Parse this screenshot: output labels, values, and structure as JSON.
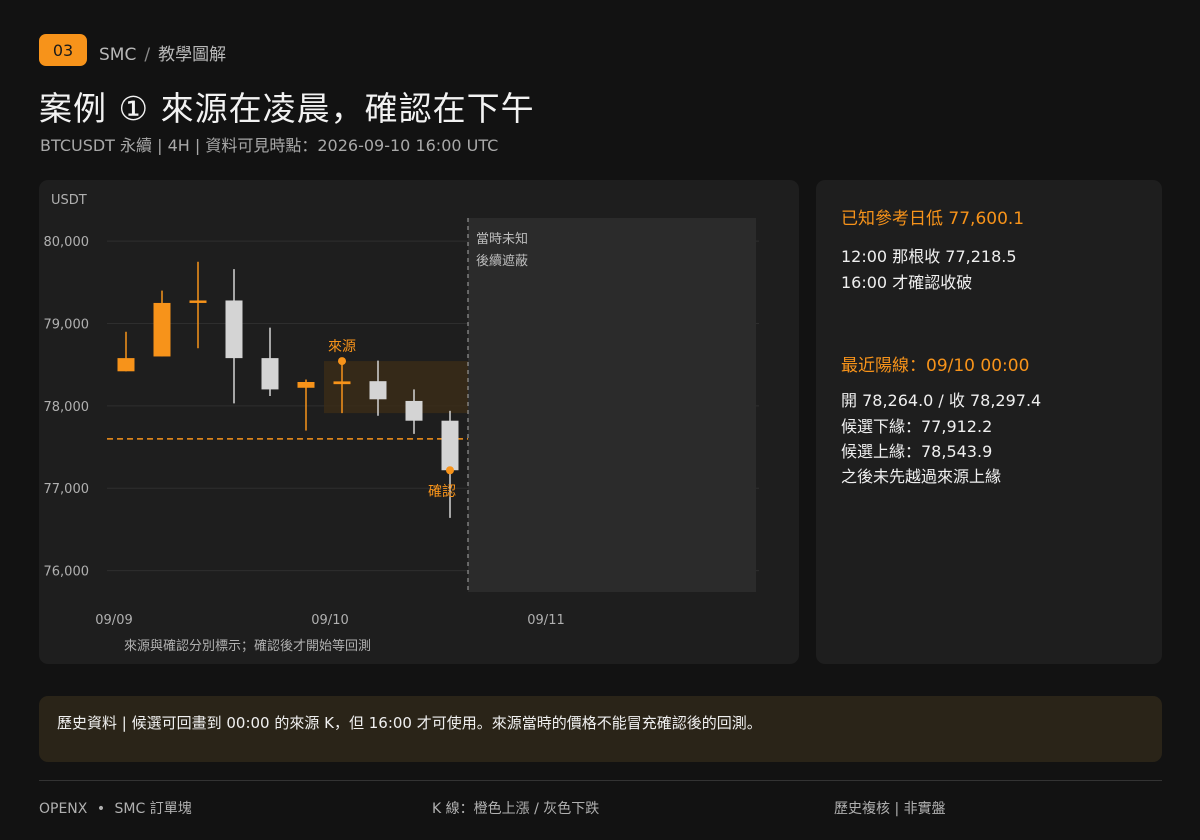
{
  "header": {
    "badge": "03",
    "breadcrumb_main": "SMC",
    "breadcrumb_sep": "/",
    "breadcrumb_sub": "教學圖解",
    "title": "案例 ① 來源在凌晨，確認在下午",
    "subtitle": "BTCUSDT 永續 | 4H | 資料可見時點：2026-09-10 16:00 UTC"
  },
  "colors": {
    "up": "#f7931a",
    "down": "#d4d4d4",
    "panel": "#1e1e1e",
    "zone": "#3a2b18"
  },
  "chart_data": {
    "type": "candlestick",
    "ylabel": "USDT",
    "ylim": [
      75400,
      80500
    ],
    "yticks": [
      {
        "value": 80000,
        "label": "80,000"
      },
      {
        "value": 79000,
        "label": "79,000"
      },
      {
        "value": 78000,
        "label": "78,000"
      },
      {
        "value": 77000,
        "label": "77,000"
      },
      {
        "value": 76000,
        "label": "76,000"
      }
    ],
    "xlabels": [
      {
        "index": 0,
        "label": "09/09"
      },
      {
        "index": 6,
        "label": "09/10"
      },
      {
        "index": 12,
        "label": "09/11"
      }
    ],
    "candles": [
      {
        "o": 78420,
        "h": 78900,
        "l": 78420,
        "c": 78580
      },
      {
        "o": 78600,
        "h": 79400,
        "l": 78600,
        "c": 79250
      },
      {
        "o": 79250,
        "h": 79750,
        "l": 78700,
        "c": 79280
      },
      {
        "o": 79280,
        "h": 79660,
        "l": 78030,
        "c": 78580
      },
      {
        "o": 78580,
        "h": 78950,
        "l": 78120,
        "c": 78200
      },
      {
        "o": 78220,
        "h": 78320,
        "l": 77700,
        "c": 78290
      },
      {
        "o": 78264.0,
        "h": 78543.9,
        "l": 77912.2,
        "c": 78297.4
      },
      {
        "o": 78300,
        "h": 78550,
        "l": 77880,
        "c": 78080
      },
      {
        "o": 78060,
        "h": 78200,
        "l": 77660,
        "c": 77820
      },
      {
        "o": 77820,
        "h": 77940,
        "l": 76640,
        "c": 77218.5
      }
    ],
    "reference_low": 77600.1,
    "source_zone": {
      "candle_index": 6,
      "low": 77912.2,
      "high": 78543.9
    },
    "source_label": "來源",
    "confirm_index": 9,
    "confirm_label": "確認",
    "mask_start_index": 9.5,
    "mask_label_1": "當時未知",
    "mask_label_2": "後續遮蔽",
    "caption": "來源與確認分別標示；確認後才開始等回測"
  },
  "info": {
    "ref_heading": "已知參考日低 77,600.1",
    "ref_line1": "12:00 那根收 77,218.5",
    "ref_line2": "16:00 才確認收破",
    "bull_heading": "最近陽線：09/10 00:00",
    "bull_line1": "開 78,264.0 / 收 78,297.4",
    "bull_line2": "候選下緣：77,912.2",
    "bull_line3": "候選上緣：78,543.9",
    "bull_line4": "之後未先越過來源上緣"
  },
  "note": "歷史資料 | 候選可回畫到 00:00 的來源 K，但 16:00 才可使用。來源當時的價格不能冒充確認後的回測。",
  "footer": {
    "left_brand": "OPENX",
    "left_dot": "•",
    "left_text": "SMC 訂單塊",
    "center": "K 線：橙色上漲 / 灰色下跌",
    "right": "歷史複核 | 非實盤"
  }
}
